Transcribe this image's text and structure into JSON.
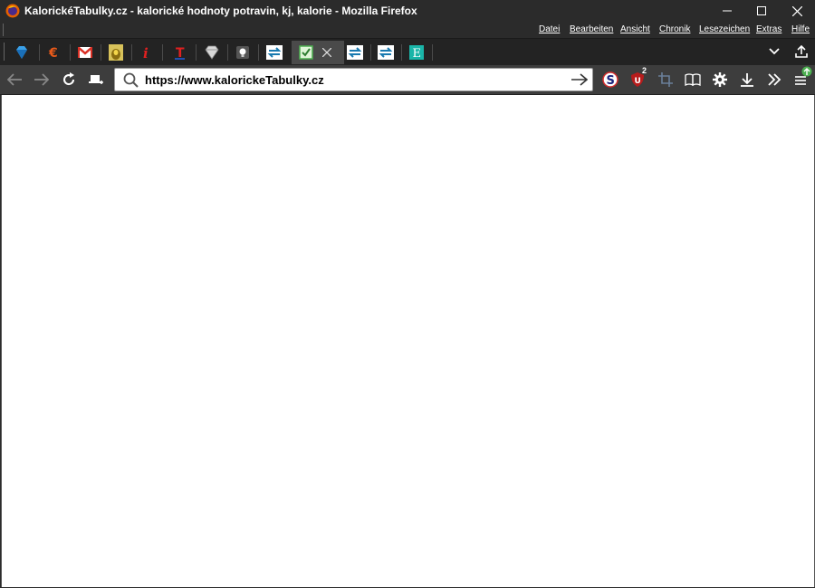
{
  "window": {
    "title": "KalorickéTabulky.cz - kalorické hodnoty potravin, kj, kalorie - Mozilla Firefox"
  },
  "menu": {
    "items": [
      "Datei",
      "Bearbeiten",
      "Ansicht",
      "Chronik",
      "Lesezeichen",
      "Extras",
      "Hilfe"
    ]
  },
  "tabs": [
    {
      "icon": "blue-diamond-icon"
    },
    {
      "icon": "euro-icon"
    },
    {
      "icon": "gmail-icon"
    },
    {
      "icon": "gold-pot-icon"
    },
    {
      "icon": "red-i-icon"
    },
    {
      "icon": "red-t-icon"
    },
    {
      "icon": "white-diamond-icon"
    },
    {
      "icon": "lightbulb-icon"
    },
    {
      "icon": "arrows-swap-icon"
    },
    {
      "icon": "checkbox-icon",
      "active": true
    },
    {
      "icon": "arrows-swap-icon"
    },
    {
      "icon": "arrows-swap-icon"
    },
    {
      "icon": "letter-e-icon"
    }
  ],
  "navbar": {
    "url": "https://www.kalorickeTabulky.cz",
    "addon_badge": "2"
  },
  "colors": {
    "chrome_dark": "#2b2b2b",
    "navbar": "#3d3d3d",
    "accent_green": "#4caf50"
  }
}
